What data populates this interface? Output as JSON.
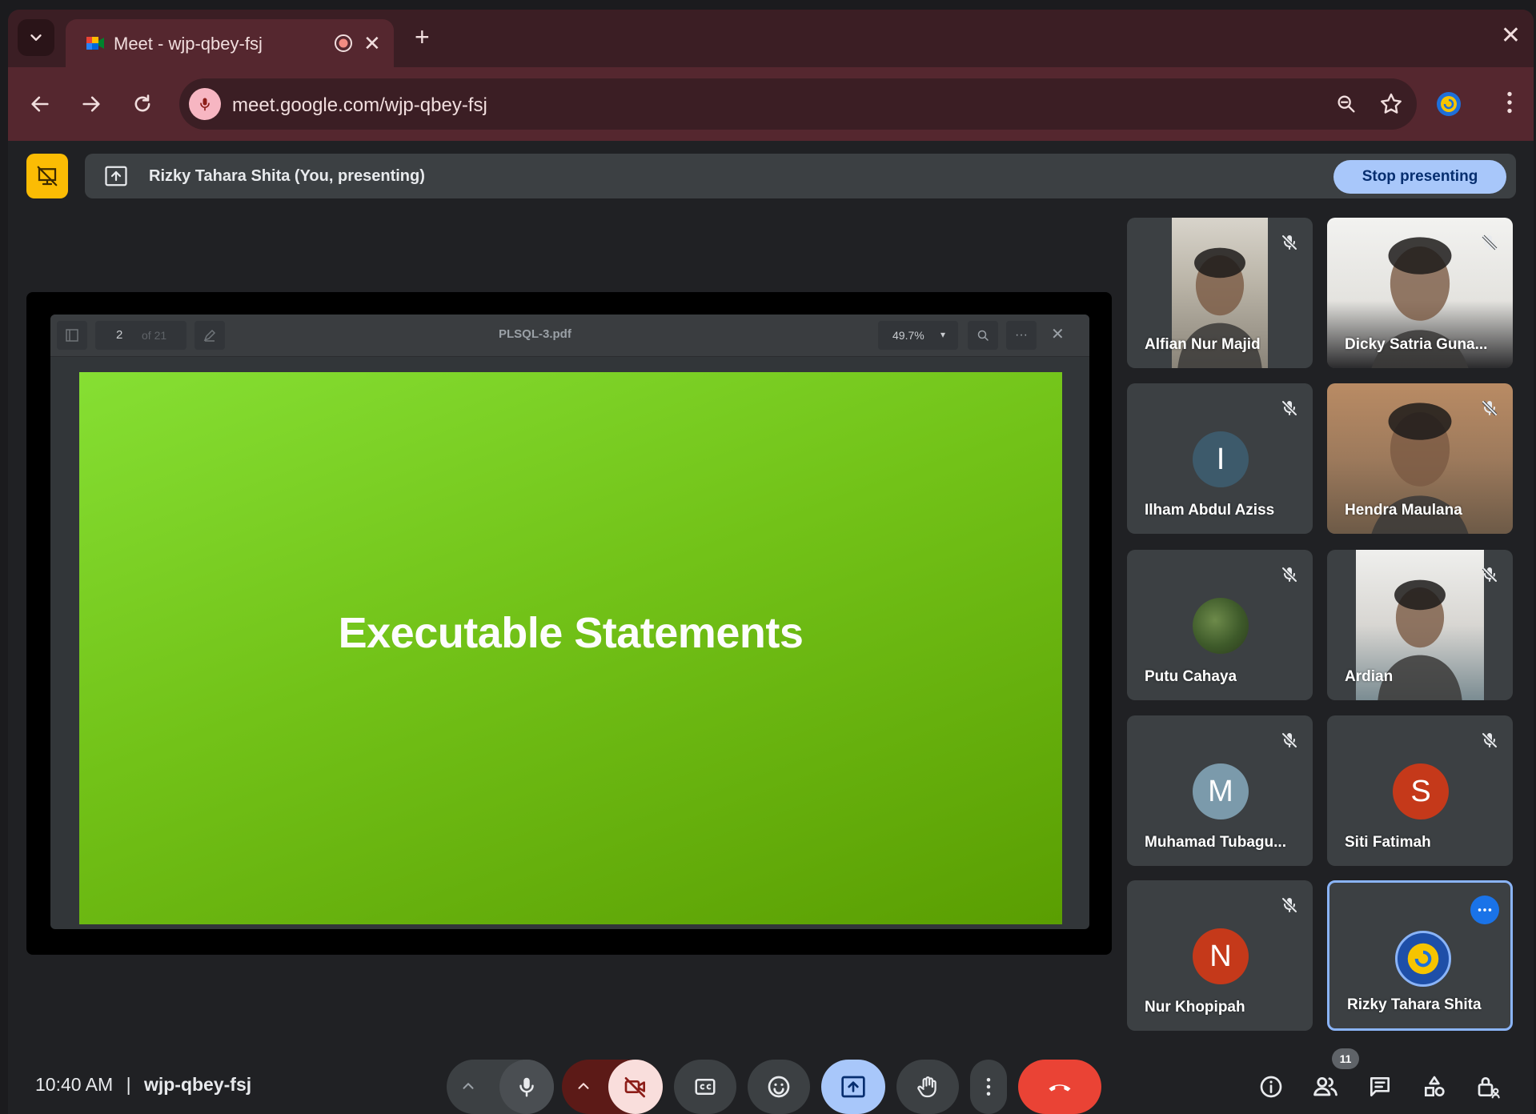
{
  "browser": {
    "tab_title": "Meet - wjp-qbey-fsj",
    "tab_close": "✕",
    "new_tab": "+",
    "window_close": "✕",
    "url": "meet.google.com/wjp-qbey-fsj"
  },
  "banner": {
    "presenting_text": "Rizky Tahara Shita (You, presenting)",
    "stop_label": "Stop presenting"
  },
  "pdf": {
    "page_number": "2",
    "page_of": "of 21",
    "filename": "PLSQL-3.pdf",
    "zoom": "49.7%",
    "zoom_caret": "▾",
    "more": "···",
    "close": "✕",
    "slide_title": "Executable Statements"
  },
  "participants": [
    {
      "name": "Alfian Nur Majid",
      "type": "video",
      "muted": true
    },
    {
      "name": "Dicky Satria Guna...",
      "type": "video",
      "muted": true
    },
    {
      "name": "Ilham Abdul Aziss",
      "type": "initial",
      "initial": "I",
      "color": "#3d5a6b",
      "muted": true
    },
    {
      "name": "Hendra Maulana",
      "type": "video",
      "muted": true
    },
    {
      "name": "Putu Cahaya",
      "type": "photo",
      "muted": true
    },
    {
      "name": "Ardian",
      "type": "video",
      "muted": true
    },
    {
      "name": "Muhamad Tubagu...",
      "type": "initial",
      "initial": "M",
      "color": "#7b9aab",
      "muted": true
    },
    {
      "name": "Siti Fatimah",
      "type": "initial",
      "initial": "S",
      "color": "#c5391a",
      "muted": true
    },
    {
      "name": "Nur Khopipah",
      "type": "initial",
      "initial": "N",
      "color": "#c5391a",
      "muted": true
    },
    {
      "name": "Rizky Tahara Shita",
      "type": "self",
      "muted": false
    }
  ],
  "bottom": {
    "time": "10:40 AM",
    "separator": "|",
    "meeting_code": "wjp-qbey-fsj",
    "people_count": "11"
  },
  "colors": {
    "accent": "#a8c7fa",
    "end_call": "#ea4335",
    "camera_off": "#f9dedc",
    "present_active": "#a8c7fa"
  }
}
